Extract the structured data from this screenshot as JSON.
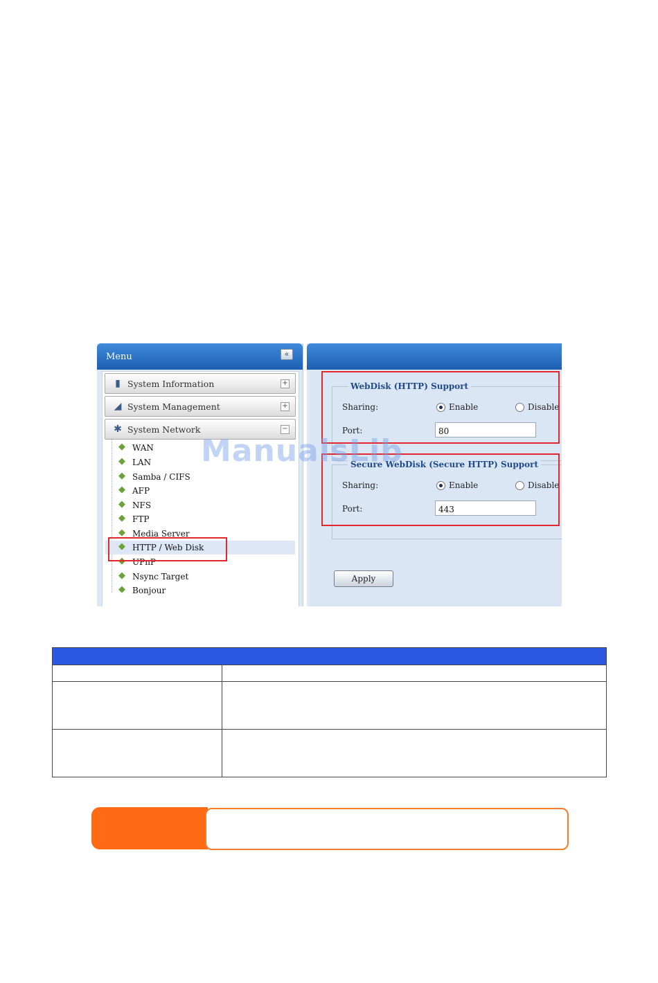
{
  "menu": {
    "title": "Menu",
    "collapse_glyph": "«",
    "sections": [
      {
        "label": "System Information",
        "icon": "system-information-icon",
        "toggle": "+"
      },
      {
        "label": "System Management",
        "icon": "system-management-icon",
        "toggle": "+"
      },
      {
        "label": "System Network",
        "icon": "system-network-icon",
        "toggle": "−"
      }
    ],
    "network_items": [
      "WAN",
      "LAN",
      "Samba / CIFS",
      "AFP",
      "NFS",
      "FTP",
      "Media Server",
      "HTTP / Web Disk",
      "UPnP",
      "Nsync Target",
      "Bonjour"
    ],
    "selected_item": "HTTP / Web Disk"
  },
  "webdisk": {
    "legend": "WebDisk (HTTP) Support",
    "sharing_label": "Sharing:",
    "enable_label": "Enable",
    "disable_label": "Disable",
    "port_label": "Port:",
    "port_value": "80",
    "enabled": true
  },
  "secure_webdisk": {
    "legend": "Secure WebDisk (Secure HTTP) Support",
    "sharing_label": "Sharing:",
    "enable_label": "Enable",
    "disable_label": "Disable",
    "port_label": "Port:",
    "port_value": "443",
    "enabled": true
  },
  "apply_label": "Apply",
  "watermark": "ManualsLib",
  "colors": {
    "header_blue": "#1d5fb3",
    "panel_bg": "#dbe6f5",
    "highlight_red": "#e2262b",
    "table_header": "#2a56e0",
    "note_orange": "#ff6a14"
  }
}
